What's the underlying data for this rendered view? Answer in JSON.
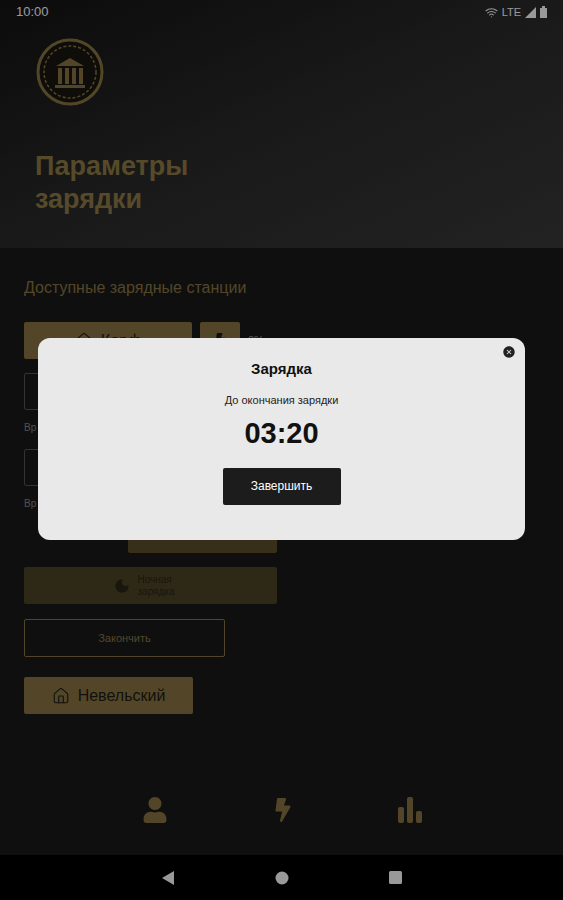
{
  "status_bar": {
    "time": "10:00",
    "network": "LTE"
  },
  "header": {
    "title": "Параметры зарядки"
  },
  "section_title": "Доступные зарядные станции",
  "stations": [
    {
      "name": "Корф",
      "expanded": true,
      "charge": "0%"
    },
    {
      "name": "Невельский",
      "expanded": false,
      "charge": ""
    }
  ],
  "form": {
    "fields": [
      {
        "label": "Вр"
      },
      {
        "label": "Вр"
      }
    ],
    "night_button": {
      "label": "Ночная зарядка",
      "disabled": true
    },
    "finish_button": "Закончить"
  },
  "dialog": {
    "title": "Зарядка",
    "subtitle": "До окончания зарядки",
    "timer": "03:20",
    "button": "Завершить"
  }
}
